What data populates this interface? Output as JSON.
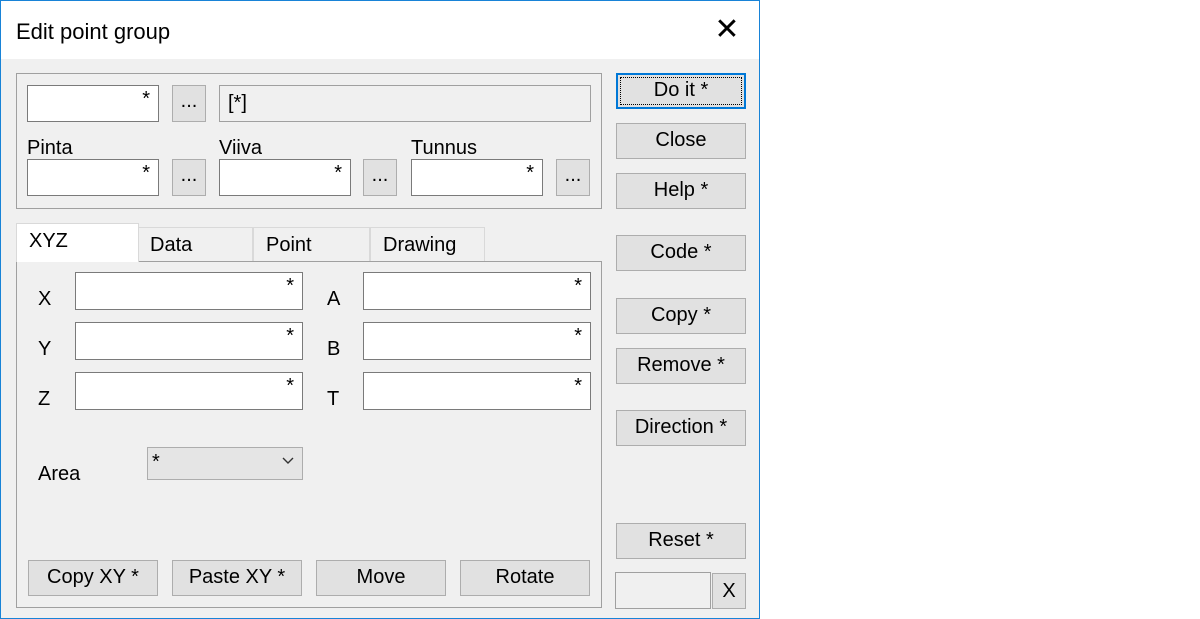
{
  "window": {
    "title": "Edit point group"
  },
  "top": {
    "field_value": "*",
    "browse_label": "...",
    "readonly_value": "[*]",
    "pinta": {
      "label": "Pinta",
      "value": "*",
      "browse": "..."
    },
    "viiva": {
      "label": "Viiva",
      "value": "*",
      "browse": "..."
    },
    "tunnus": {
      "label": "Tunnus",
      "value": "*",
      "browse": "..."
    }
  },
  "tabs": [
    {
      "label": "XYZ",
      "active": true
    },
    {
      "label": "Data",
      "active": false
    },
    {
      "label": "Point",
      "active": false
    },
    {
      "label": "Drawing",
      "active": false
    }
  ],
  "xyz": {
    "x": {
      "label": "X",
      "value": "*"
    },
    "y": {
      "label": "Y",
      "value": "*"
    },
    "z": {
      "label": "Z",
      "value": "*"
    },
    "a": {
      "label": "A",
      "value": "*"
    },
    "b": {
      "label": "B",
      "value": "*"
    },
    "t": {
      "label": "T",
      "value": "*"
    },
    "area": {
      "label": "Area",
      "selected": "*"
    },
    "buttons": {
      "copy_xy": "Copy XY *",
      "paste_xy": "Paste XY *",
      "move": "Move",
      "rotate": "Rotate"
    }
  },
  "side": {
    "do_it": "Do it *",
    "close": "Close",
    "help": "Help *",
    "code": "Code *",
    "copy": "Copy *",
    "remove": "Remove *",
    "direction": "Direction *",
    "reset": "Reset *",
    "clear_x": "X",
    "bottom_value": ""
  },
  "icons": {
    "close": "close-icon",
    "dropdown": "chevron-down-icon"
  }
}
